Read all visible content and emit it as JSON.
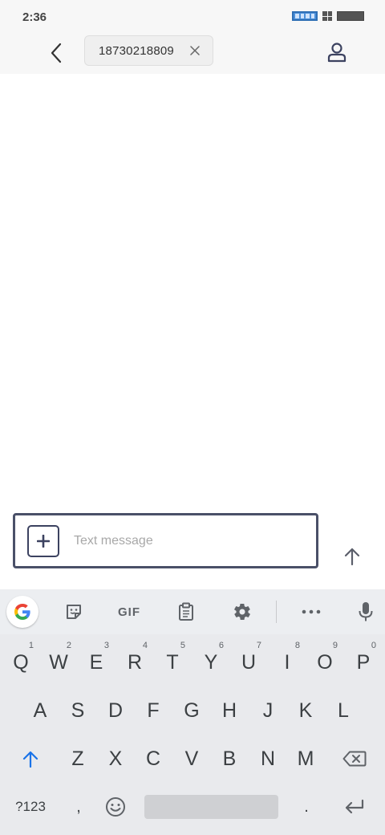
{
  "status_bar": {
    "time": "2:36",
    "icons": [
      "network-icon",
      "grid-icon",
      "battery-icon"
    ]
  },
  "header": {
    "back_icon": "chevron-left-icon",
    "recipient_number": "18730218809",
    "chip_close_icon": "close-icon",
    "contact_icon": "person-icon"
  },
  "compose": {
    "attach_icon": "plus-icon",
    "placeholder": "Text message",
    "value": "",
    "send_icon": "arrow-up-icon"
  },
  "keyboard": {
    "toolbar": {
      "google_icon": "google-g-icon",
      "sticker_icon": "sticker-icon",
      "gif_label": "GIF",
      "clipboard_icon": "clipboard-icon",
      "settings_icon": "gear-icon",
      "more_icon": "more-icon",
      "mic_icon": "mic-icon"
    },
    "row1": [
      {
        "key": "Q",
        "hint": "1"
      },
      {
        "key": "W",
        "hint": "2"
      },
      {
        "key": "E",
        "hint": "3"
      },
      {
        "key": "R",
        "hint": "4"
      },
      {
        "key": "T",
        "hint": "5"
      },
      {
        "key": "Y",
        "hint": "6"
      },
      {
        "key": "U",
        "hint": "7"
      },
      {
        "key": "I",
        "hint": "8"
      },
      {
        "key": "O",
        "hint": "9"
      },
      {
        "key": "P",
        "hint": "0"
      }
    ],
    "row2": [
      "A",
      "S",
      "D",
      "F",
      "G",
      "H",
      "J",
      "K",
      "L"
    ],
    "row3": [
      "Z",
      "X",
      "C",
      "V",
      "B",
      "N",
      "M"
    ],
    "shift_icon": "shift-icon",
    "backspace_icon": "backspace-icon",
    "symbols_label": "?123",
    "comma_label": ",",
    "emoji_icon": "emoji-icon",
    "period_label": ".",
    "enter_icon": "enter-icon"
  },
  "colors": {
    "accent": "#4a5068",
    "shift_active": "#1a73e8",
    "keyboard_bg": "#e9eaed"
  }
}
